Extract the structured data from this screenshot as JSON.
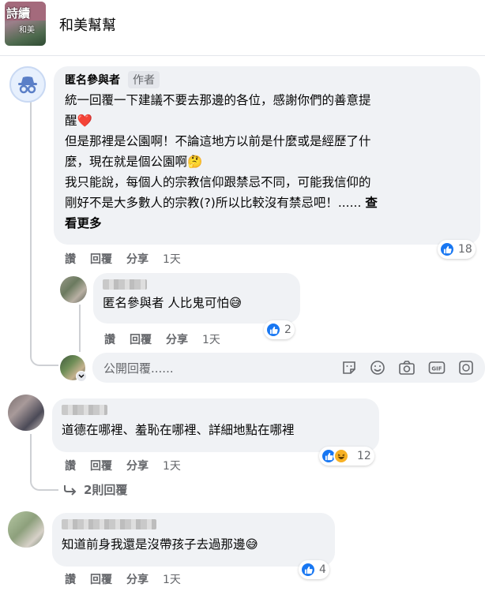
{
  "group": {
    "name": "和美幫幫",
    "avatar_text_top": "詩續",
    "avatar_text_bottom": "和美"
  },
  "comments": [
    {
      "author": "匿名參與者",
      "author_badge": "作者",
      "lines": [
        "統一回覆一下建議不要去那邊的各位，感謝你們的善意提",
        "醒❤️",
        "但是那裡是公園啊！不論這地方以前是什麼或是經歷了什",
        "麼，現在就是個公園啊🤔",
        "我只能說，每個人的宗教信仰跟禁忌不同，可能我信仰的",
        "剛好不是大多數人的宗教(?)所以比較沒有禁忌吧！......"
      ],
      "see_more_part1": "查",
      "see_more_part2": "看更多",
      "actions": {
        "like": "讚",
        "reply": "回覆",
        "share": "分享",
        "time": "1天"
      },
      "reaction_count": "18"
    },
    {
      "author": "",
      "text": "匿名參與者 人比鬼可怕😅",
      "actions": {
        "like": "讚",
        "reply": "回覆",
        "share": "分享",
        "time": "1天"
      },
      "reaction_count": "2"
    },
    {
      "author": "",
      "text": "道德在哪裡、羞恥在哪裡、詳細地點在哪裡",
      "actions": {
        "like": "讚",
        "reply": "回覆",
        "share": "分享",
        "time": "1天"
      },
      "reaction_count": "12"
    },
    {
      "author": "",
      "text": "知道前身我還是沒帶孩子去過那邊😅",
      "actions": {
        "like": "讚",
        "reply": "回覆",
        "share": "分享",
        "time": "1天"
      },
      "reaction_count": "4"
    }
  ],
  "reply_box": {
    "placeholder": "公開回覆......"
  },
  "view_replies": "2則回覆",
  "icons": [
    "anonymous-icon",
    "like-icon",
    "haha-icon",
    "sticker-icon",
    "emoji-icon",
    "camera-icon",
    "gif-icon",
    "reply-arrow-icon"
  ],
  "colors": {
    "like_blue": "#1877f2",
    "haha_yellow": "#f7b125",
    "bubble_bg": "#f0f2f5",
    "muted_text": "#65676b"
  }
}
